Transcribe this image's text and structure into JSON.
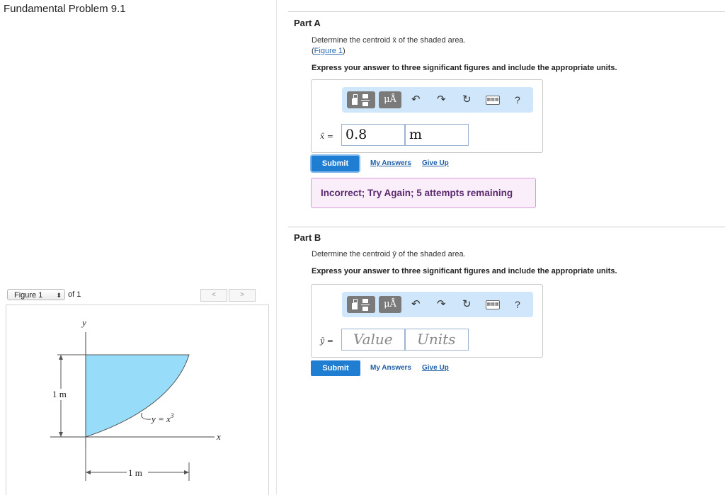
{
  "problem_title": "Fundamental Problem 9.1",
  "figure_panel": {
    "select_value": "Figure 1",
    "of_text": "of 1",
    "prev_glyph": "<",
    "next_glyph": ">",
    "labels": {
      "y_axis": "y",
      "x_axis": "x",
      "height_dim": "1 m",
      "width_dim": "1 m",
      "curve_eq": "y = x",
      "curve_exp": "3"
    },
    "shade_color": "#97dcf8"
  },
  "part_a": {
    "title": "Part A",
    "prompt": "Determine the centroid x̄ of the shaded area.",
    "figure_link_open": "(",
    "figure_link": "Figure 1",
    "figure_link_close": ")",
    "express": "Express your answer to three significant figures and include the appropriate units.",
    "var_label": "x̄ =",
    "value": "0.8",
    "units": "m",
    "submit_label": "Submit",
    "my_answers": "My Answers",
    "give_up": "Give Up",
    "feedback": "Incorrect; Try Again; 5 attempts remaining"
  },
  "part_b": {
    "title": "Part B",
    "prompt": "Determine the centroid ȳ of the shaded area.",
    "express": "Express your answer to three significant figures and include the appropriate units.",
    "var_label": "ȳ =",
    "value_placeholder": "Value",
    "units_placeholder": "Units",
    "submit_label": "Submit",
    "my_answers": "My Answers",
    "give_up": "Give Up"
  },
  "toolbar": {
    "units_glyph": "μÅ",
    "undo_glyph": "↶",
    "redo_glyph": "↷",
    "reset_glyph": "↻",
    "keyboard_glyph": "▦▦▦",
    "help_glyph": "?"
  },
  "colors": {
    "accent_blue": "#1f7ed2",
    "feedback_bg": "#fbeefb",
    "feedback_text": "#5b2a6e",
    "toolbar_bg": "#cfe6fb"
  }
}
